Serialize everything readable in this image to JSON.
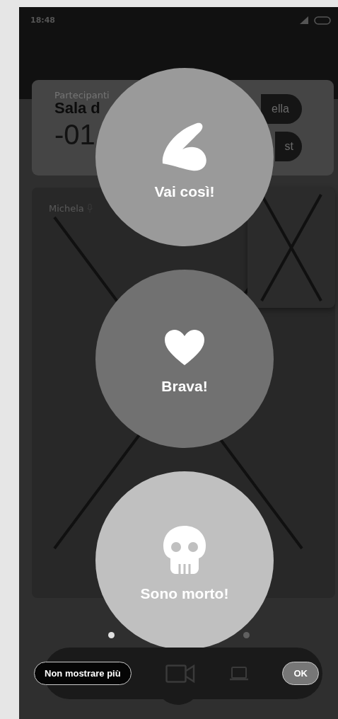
{
  "status_bar": {
    "time": "18:48"
  },
  "room_card": {
    "label": "Partecipanti",
    "title": "Sala d",
    "counter": "-01",
    "buttons": [
      "ella",
      "st"
    ]
  },
  "main_tile": {
    "name": "Michela"
  },
  "page_dots": [
    {
      "selected": true
    },
    {
      "selected": false
    }
  ],
  "reactions": [
    {
      "kind": "muscle",
      "label": "Vai così!",
      "color": "#9a9a9a"
    },
    {
      "kind": "heart",
      "label": "Brava!",
      "color": "#717171"
    },
    {
      "kind": "skull",
      "label": "Sono morto!",
      "color": "#c0c0c0"
    }
  ],
  "footer": {
    "dismiss_button": "Non mostrare più",
    "ok_button": "OK"
  }
}
